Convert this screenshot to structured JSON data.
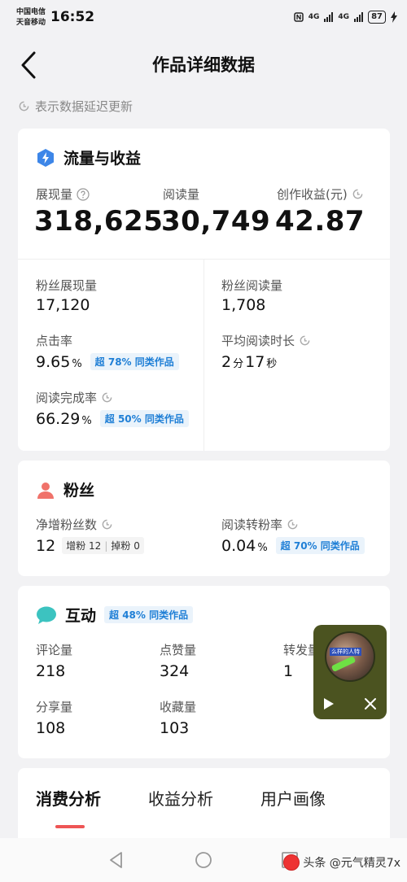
{
  "status_bar": {
    "carrier_1": "中国电信",
    "carrier_2": "天音移动",
    "time": "16:52",
    "signal_1": "4G",
    "signal_2": "4G",
    "battery": "87"
  },
  "header": {
    "title": "作品详细数据"
  },
  "delay_note": "表示数据延迟更新",
  "traffic": {
    "title": "流量与收益",
    "impressions_label": "展现量",
    "impressions_value": "318,625",
    "reads_label": "阅读量",
    "reads_value": "30,749",
    "income_label": "创作收益(元)",
    "income_value": "42.87",
    "fan_impressions_label": "粉丝展现量",
    "fan_impressions_value": "17,120",
    "fan_reads_label": "粉丝阅读量",
    "fan_reads_value": "1,708",
    "ctr_label": "点击率",
    "ctr_value": "9.65",
    "ctr_unit": "%",
    "ctr_badge": "超 78% 同类作品",
    "avg_time_label": "平均阅读时长",
    "avg_time_min": "2",
    "avg_time_min_unit": "分",
    "avg_time_sec": "17",
    "avg_time_sec_unit": "秒",
    "completion_label": "阅读完成率",
    "completion_value": "66.29",
    "completion_unit": "%",
    "completion_badge": "超 50% 同类作品"
  },
  "fans": {
    "title": "粉丝",
    "net_label": "净增粉丝数",
    "net_value": "12",
    "gain_label": "增粉",
    "gain_value": "12",
    "loss_label": "掉粉",
    "loss_value": "0",
    "convert_label": "阅读转粉率",
    "convert_value": "0.04",
    "convert_unit": "%",
    "convert_badge": "超 70% 同类作品"
  },
  "interaction": {
    "title": "互动",
    "badge": "超 48% 同类作品",
    "comments_label": "评论量",
    "comments_value": "218",
    "likes_label": "点赞量",
    "likes_value": "324",
    "shares_fwd_label": "转发量",
    "shares_fwd_value": "1",
    "share_label": "分享量",
    "share_value": "108",
    "fav_label": "收藏量",
    "fav_value": "103"
  },
  "tabs": {
    "consumption": "消费分析",
    "income": "收益分析",
    "audience": "用户画像"
  },
  "mini_player": {
    "thumb_text": "么样的人特"
  },
  "watermark": "头条 @元气精灵7x",
  "colors": {
    "accent_blue": "#1f7fd6",
    "tab_indicator": "#e55555",
    "mini_player_bg": "#4b5320"
  },
  "icons": {
    "traffic": "lightning-badge-icon",
    "fans": "person-icon",
    "interaction": "speech-bubble-icon"
  }
}
